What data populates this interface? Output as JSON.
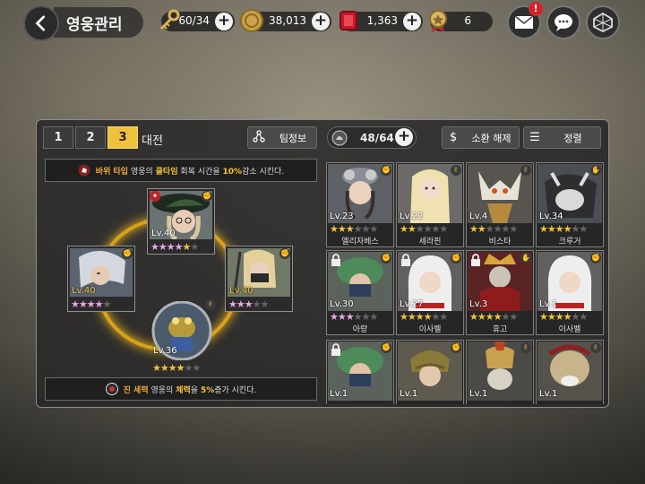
{
  "header": {
    "title": "영웅관리",
    "resources": {
      "stamina": "60/34",
      "gold": "38,013",
      "ruby": "1,363",
      "honor": "6"
    },
    "mail_badge": "!"
  },
  "team_tabs": [
    "1",
    "2",
    "3"
  ],
  "team_tab_active": "3",
  "tab_suffix": "대전",
  "buttons": {
    "team_info": "팀정보",
    "hero_count": "48/64",
    "release": "소환 해제",
    "sort": "정렬"
  },
  "banners": {
    "top_part1": "바위 타입",
    "top_part2": "영웅의",
    "top_part3": "쿨타임",
    "top_part4": "회복 시간을",
    "top_part5": "10%",
    "top_part6": "감소 시킨다.",
    "bottom_part1": "진 세력",
    "bottom_part2": "영웅의",
    "bottom_part3": "체력",
    "bottom_part4": "을",
    "bottom_part5": "5%",
    "bottom_part6": "증가 시킨다."
  },
  "formation": [
    {
      "pos": "top",
      "level": "Lv.40",
      "stars": [
        5,
        0,
        0
      ],
      "style": "pink"
    },
    {
      "pos": "left",
      "level": "Lv.40",
      "stars": [
        3,
        1,
        1
      ],
      "style": "pink"
    },
    {
      "pos": "right",
      "level": "Lv.40",
      "stars": [
        3,
        2,
        0
      ],
      "style": "pink"
    },
    {
      "pos": "bottom",
      "level": "Lv.36",
      "stars": [
        4,
        0,
        1
      ],
      "style": "gold"
    }
  ],
  "heroes": [
    {
      "level": "Lv.23",
      "name": "엘리자베스",
      "locked": false
    },
    {
      "level": "Lv.22",
      "name": "세라핀",
      "locked": false
    },
    {
      "level": "Lv.4",
      "name": "비스타",
      "locked": false
    },
    {
      "level": "Lv.34",
      "name": "크루거",
      "locked": false
    },
    {
      "level": "Lv.30",
      "name": "아랑",
      "locked": true
    },
    {
      "level": "Lv.27",
      "name": "이사벨",
      "locked": true
    },
    {
      "level": "Lv.3",
      "name": "휴고",
      "locked": true
    },
    {
      "level": "Lv.1",
      "name": "이사벨",
      "locked": false
    },
    {
      "level": "Lv.1",
      "name": "",
      "locked": true
    },
    {
      "level": "Lv.1",
      "name": "",
      "locked": false
    },
    {
      "level": "Lv.1",
      "name": "",
      "locked": false
    },
    {
      "level": "Lv.1",
      "name": "",
      "locked": false
    }
  ],
  "colors": {
    "accent": "#f0c23c",
    "star_gold": "#f2c23a",
    "star_pink": "#e9a7e6",
    "badge_red": "#d0242b"
  }
}
